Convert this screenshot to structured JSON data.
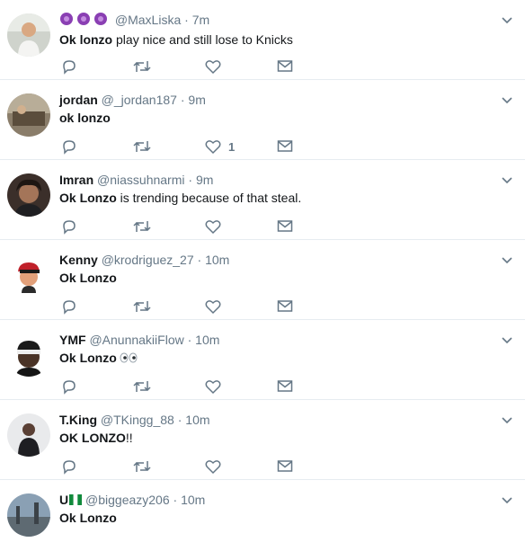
{
  "colors": {
    "icon": "#657786",
    "border": "#e6ecf0",
    "name": "#14171a",
    "muted": "#657786"
  },
  "tweets": [
    {
      "name": "",
      "badges": "purple-flower-emoji x3",
      "handle": "@MaxLiska",
      "sep": "·",
      "time": "7m",
      "bold_text": "Ok lonzo",
      "rest_text": " play nice and still lose to Knicks",
      "likes": ""
    },
    {
      "name": "jordan",
      "handle": "@_jordan187",
      "sep": "·",
      "time": "9m",
      "bold_text": "ok lonzo",
      "rest_text": "",
      "likes": "1"
    },
    {
      "name": "Imran",
      "handle": "@niassuhnarmi",
      "sep": "·",
      "time": "9m",
      "bold_text": "Ok Lonzo",
      "rest_text": " is trending because of that steal.",
      "likes": ""
    },
    {
      "name": "Kenny",
      "handle": "@krodriguez_27",
      "sep": "·",
      "time": "10m",
      "bold_text": "Ok Lonzo",
      "rest_text": "",
      "likes": ""
    },
    {
      "name": "YMF",
      "handle": "@AnunnakiiFlow",
      "sep": "·",
      "time": "10m",
      "bold_text": "Ok Lonzo",
      "rest_text": "",
      "emoji": "eyes-emoji",
      "likes": ""
    },
    {
      "name": "T.King",
      "handle": "@TKingg_88",
      "sep": "·",
      "time": "10m",
      "bold_text": "OK LONZO",
      "rest_text": "!!",
      "likes": ""
    },
    {
      "name": "U",
      "flag": "nigeria-flag-emoji",
      "handle": "@biggeazy206",
      "sep": "·",
      "time": "10m",
      "bold_text": "Ok Lonzo",
      "rest_text": "",
      "likes": ""
    }
  ],
  "icons": {
    "reply": "reply-icon",
    "retweet": "retweet-icon",
    "like": "heart-icon",
    "dm": "envelope-icon",
    "menu": "chevron-down-icon"
  }
}
